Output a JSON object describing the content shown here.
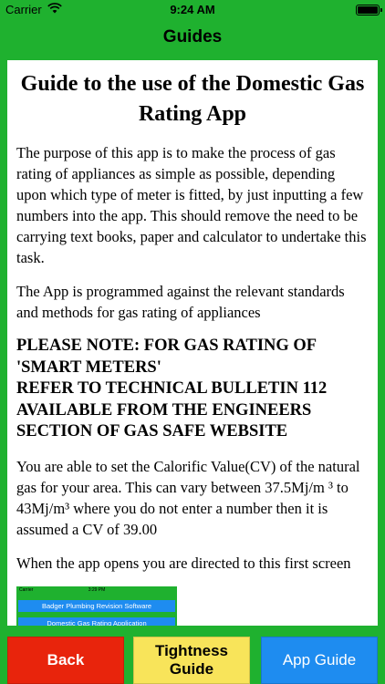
{
  "status_bar": {
    "carrier": "Carrier",
    "time": "9:24 AM"
  },
  "nav": {
    "title": "Guides"
  },
  "document": {
    "title": "Guide to the use of the Domestic Gas Rating App",
    "paragraph1": "The purpose of this app is to make the process of gas rating of appliances as simple as possible, depending upon which type of meter is fitted, by just inputting a few numbers into the app. This should remove the need to be carrying text books, paper and calculator to undertake this task.",
    "paragraph2": "The App is programmed against the relevant standards and methods for gas rating of appliances",
    "note_line1": "PLEASE NOTE: FOR GAS RATING OF 'SMART METERS'",
    "note_line2": "REFER TO TECHNICAL BULLETIN 112 AVAILABLE FROM THE ENGINEERS SECTION OF GAS SAFE WEBSITE",
    "paragraph3": "You are able to set the Calorific Value(CV) of the natural gas for your area. This can vary between 37.5Mj/m ³ to 43Mj/m³ where you do not enter a number then it is assumed a CV of 39.00",
    "paragraph4": "When the app opens you are directed to this first screen",
    "thumbnail": {
      "carrier": "Carrier",
      "time": "3:29 PM",
      "bar1": "Badger Plumbing Revision Software",
      "bar2": "Domestic Gas Rating Application"
    }
  },
  "buttons": {
    "back": "Back",
    "tightness": "Tightness Guide",
    "app_guide": "App Guide"
  },
  "colors": {
    "background": "#1fb12f",
    "back_button": "#e8240c",
    "tightness_button": "#f8e45a",
    "app_guide_button": "#1e8cf0"
  },
  "icons": [
    "wifi-icon",
    "battery-icon"
  ]
}
